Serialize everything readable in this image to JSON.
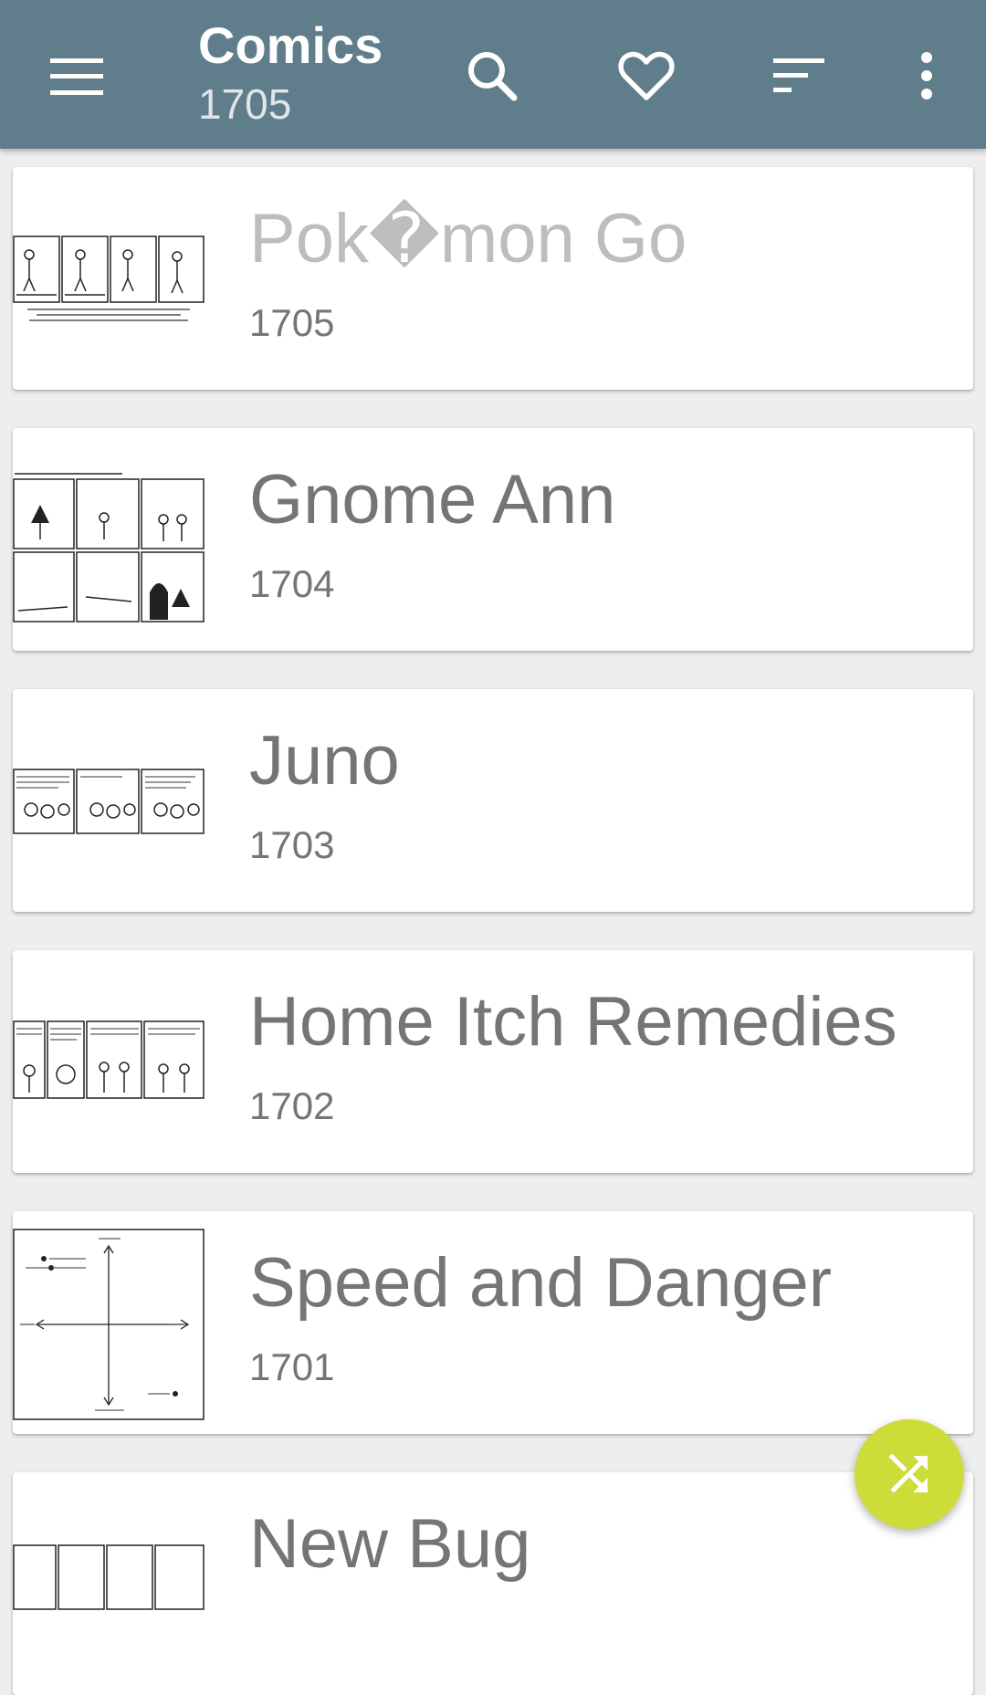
{
  "appbar": {
    "title": "Comics",
    "subtitle": "1705",
    "icons": [
      "menu-icon",
      "search-icon",
      "heart-icon",
      "sort-icon",
      "overflow-menu-icon"
    ]
  },
  "comics": [
    {
      "title": "Pok�mon Go",
      "number": "1705",
      "faded": true
    },
    {
      "title": "Gnome Ann",
      "number": "1704"
    },
    {
      "title": "Juno",
      "number": "1703"
    },
    {
      "title": "Home Itch Remedies",
      "number": "1702"
    },
    {
      "title": "Speed and Danger",
      "number": "1701"
    },
    {
      "title": "New Bug",
      "number": ""
    }
  ],
  "fab": {
    "icon": "shuffle-icon"
  },
  "colors": {
    "appbar": "#607d8b",
    "fab": "#cddc39",
    "text": "#757575"
  }
}
